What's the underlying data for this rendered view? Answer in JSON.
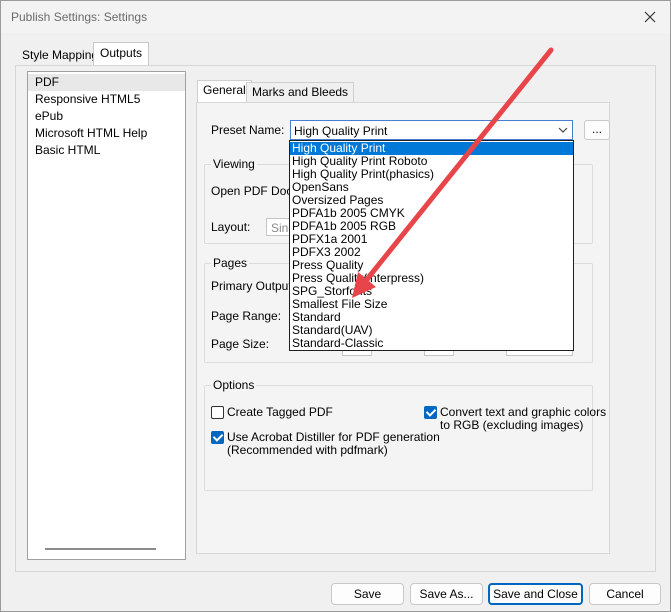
{
  "window": {
    "title": "Publish Settings: Settings",
    "close_icon": "close-icon"
  },
  "outer_tabs": [
    {
      "label": "Style Mapping"
    },
    {
      "label": "Outputs"
    }
  ],
  "outputs": [
    {
      "label": "PDF"
    },
    {
      "label": "Responsive HTML5"
    },
    {
      "label": "ePub"
    },
    {
      "label": "Microsoft HTML Help"
    },
    {
      "label": "Basic HTML"
    }
  ],
  "inner_tabs": [
    {
      "label": "General"
    },
    {
      "label": "Marks and Bleeds"
    }
  ],
  "preset": {
    "label": "Preset Name:",
    "value": "High Quality Print",
    "browse_label": "...",
    "options": [
      "High Quality Print",
      "High Quality Print Roboto",
      "High Quality Print(phasics)",
      "OpenSans",
      "Oversized Pages",
      "PDFA1b 2005 CMYK",
      "PDFA1b 2005 RGB",
      "PDFX1a 2001",
      "PDFX3 2002",
      "Press Quality",
      "Press Quality(interpress)",
      "SPG_Storfonts",
      "Smallest File Size",
      "Standard",
      "Standard(UAV)",
      "Standard-Classic"
    ]
  },
  "viewing": {
    "title": "Viewing",
    "open_label": "Open PDF Docu",
    "layout_label": "Layout:",
    "layout_value": "Sing"
  },
  "pages": {
    "title": "Pages",
    "primary_label": "Primary Output P",
    "range_label": "Page Range:",
    "size_label": "Page Size:"
  },
  "options": {
    "title": "Options",
    "tagged_pdf": {
      "label": "Create Tagged PDF",
      "checked": false
    },
    "distiller": {
      "label": "Use Acrobat Distiller for PDF generation",
      "sub": "(Recommended with pdfmark)",
      "checked": true
    },
    "convert": {
      "label": "Convert text and graphic colors",
      "sub": "to RGB (excluding images)",
      "checked": true
    }
  },
  "buttons": {
    "save": "Save",
    "save_as": "Save As...",
    "save_close": "Save and Close",
    "cancel": "Cancel"
  },
  "annotation": {
    "arrow_color": "#e8454a"
  }
}
